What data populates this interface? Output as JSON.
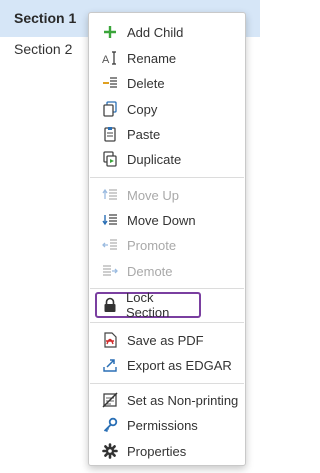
{
  "sections": [
    {
      "label": "Section 1"
    },
    {
      "label": "Section 2"
    }
  ],
  "menu": {
    "items": [
      {
        "label": "Add Child",
        "icon": "plus-icon"
      },
      {
        "label": "Rename",
        "icon": "rename-cursor-icon"
      },
      {
        "label": "Delete",
        "icon": "delete-list-icon"
      },
      {
        "label": "Copy",
        "icon": "copy-icon"
      },
      {
        "label": "Paste",
        "icon": "clipboard-icon"
      },
      {
        "label": "Duplicate",
        "icon": "duplicate-icon"
      },
      {
        "label": "Move Up",
        "icon": "move-up-icon",
        "disabled": true
      },
      {
        "label": "Move Down",
        "icon": "move-down-icon"
      },
      {
        "label": "Promote",
        "icon": "promote-icon",
        "disabled": true
      },
      {
        "label": "Demote",
        "icon": "demote-icon",
        "disabled": true
      },
      {
        "label": "Lock Section",
        "icon": "lock-icon",
        "highlighted": true
      },
      {
        "label": "Save as PDF",
        "icon": "pdf-icon"
      },
      {
        "label": "Export as EDGAR",
        "icon": "export-icon"
      },
      {
        "label": "Set as Non-printing",
        "icon": "no-print-icon"
      },
      {
        "label": "Permissions",
        "icon": "key-icon"
      },
      {
        "label": "Properties",
        "icon": "gear-icon"
      }
    ]
  },
  "colors": {
    "selection": "#d6e6f7",
    "highlight_border": "#7a3fa0",
    "accent_green": "#3aa53a",
    "accent_blue": "#2a6fb5"
  }
}
